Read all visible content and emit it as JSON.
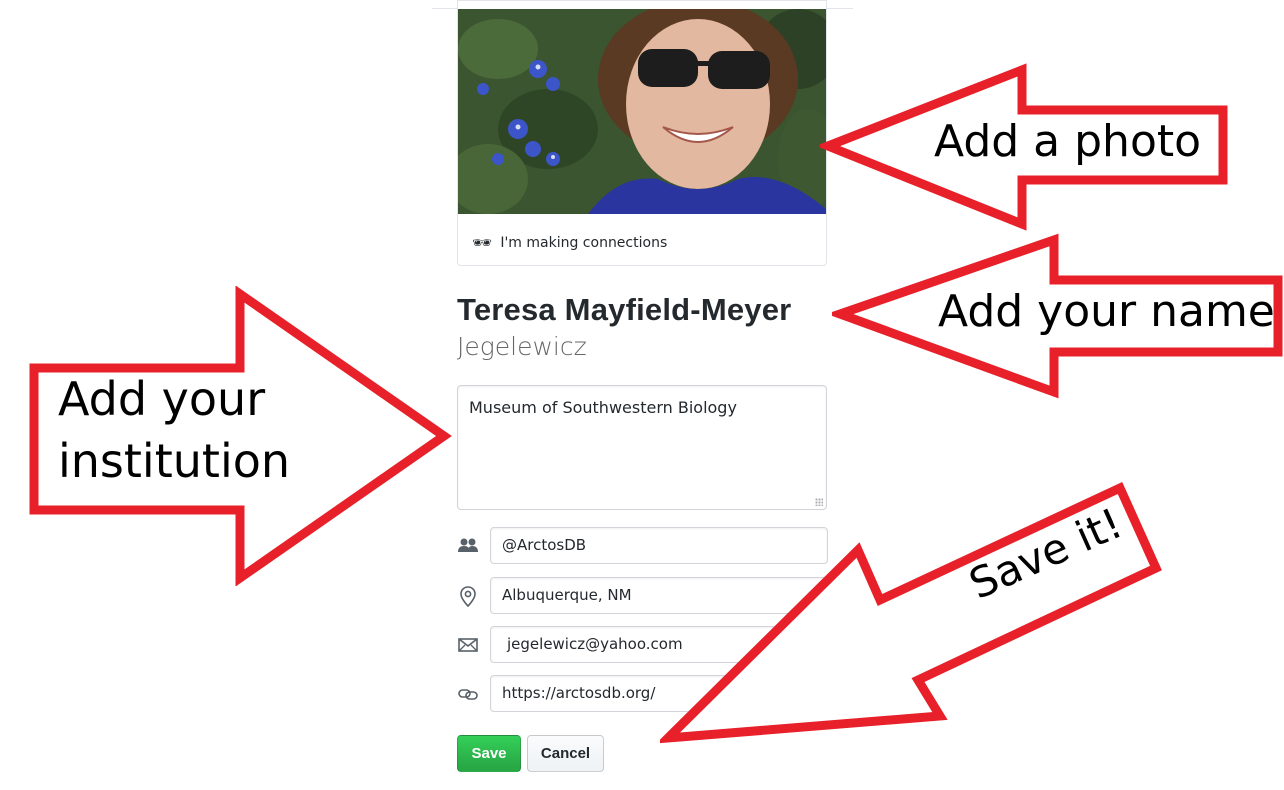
{
  "profile": {
    "status_emoji": "🕶",
    "status_text": "I'm making connections",
    "name": "Teresa Mayfield-Meyer",
    "login": "Jegelewicz",
    "bio": "Museum of Southwestern Biology"
  },
  "fields": {
    "company": "@ArctosDB",
    "location": "Albuquerque, NM",
    "email": "jegelewicz@yahoo.com",
    "website": "https://arctosdb.org/"
  },
  "buttons": {
    "save": "Save",
    "cancel": "Cancel"
  },
  "callouts": {
    "photo": "Add a photo",
    "name": "Add your name",
    "institution_line1": "Add your",
    "institution_line2": "institution",
    "save": "Save it!"
  },
  "colors": {
    "callout_red": "#e8202a",
    "save_green": "#2ea44f"
  }
}
